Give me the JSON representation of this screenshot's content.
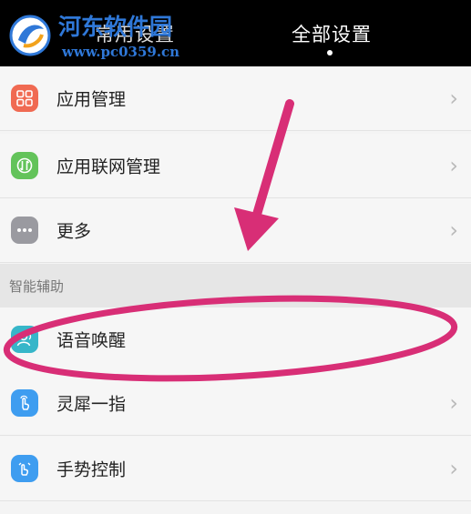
{
  "watermark": {
    "title": "河东软件园",
    "url": "www.pc0359.cn"
  },
  "tabs": [
    {
      "label": "常用设置",
      "active": false
    },
    {
      "label": "全部设置",
      "active": true
    }
  ],
  "rows": [
    {
      "label": "应用管理",
      "icon": "app-grid-icon",
      "color": "#f06a52"
    },
    {
      "label": "应用联网管理",
      "icon": "network-icon",
      "color": "#63c35a"
    },
    {
      "label": "更多",
      "icon": "more-dots-icon",
      "color": "#9a9aa0"
    }
  ],
  "section": {
    "label": "智能辅助"
  },
  "rows2": [
    {
      "label": "语音唤醒",
      "icon": "voice-wake-icon",
      "color": "#37b6c9"
    },
    {
      "label": "灵犀一指",
      "icon": "finger-touch-icon",
      "color": "#3e9df0"
    },
    {
      "label": "手势控制",
      "icon": "gesture-icon",
      "color": "#3e9df0"
    }
  ],
  "annotation": {
    "color": "#d82e76"
  }
}
